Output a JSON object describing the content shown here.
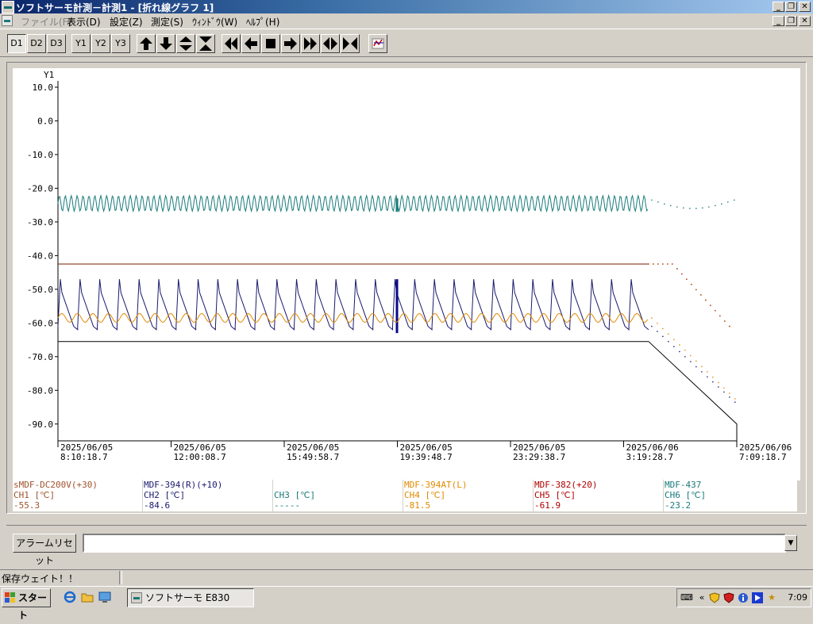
{
  "window": {
    "title": "ソフトサーモ計測－計測1 - [折れ線グラフ 1]",
    "min_glyph": "_",
    "restore_glyph": "❐",
    "close_glyph": "✕"
  },
  "menu": {
    "items": [
      {
        "label": "ファイル(F)",
        "enabled": false
      },
      {
        "label": "表示(D)",
        "enabled": true
      },
      {
        "label": "設定(Z)",
        "enabled": true
      },
      {
        "label": "測定(S)",
        "enabled": true
      },
      {
        "label": "ｳｨﾝﾄﾞｳ(W)",
        "enabled": true
      },
      {
        "label": "ﾍﾙﾌﾟ(H)",
        "enabled": true
      }
    ]
  },
  "toolbar": {
    "display_buttons": [
      "D1",
      "D2",
      "D3"
    ],
    "axis_buttons": [
      "Y1",
      "Y2",
      "Y3"
    ],
    "arrow_buttons": [
      "arrow-up-icon",
      "arrow-down-icon",
      "expand-vertical-icon",
      "shrink-vertical-icon"
    ],
    "nav_buttons": [
      "fast-rewind-icon",
      "step-back-icon",
      "stop-icon",
      "step-forward-icon",
      "fast-forward-icon",
      "expand-horizontal-icon",
      "shrink-horizontal-icon"
    ],
    "extra_button": "graph-settings-icon"
  },
  "chart_data": {
    "type": "line",
    "y_axis_title": "Y1",
    "ylim": [
      -95,
      10
    ],
    "y_ticks": [
      {
        "value": 10,
        "label": "10.0"
      },
      {
        "value": 0,
        "label": "0.0"
      },
      {
        "value": -10,
        "label": "-10.0"
      },
      {
        "value": -20,
        "label": "-20.0"
      },
      {
        "value": -30,
        "label": "-30.0"
      },
      {
        "value": -40,
        "label": "-40.0"
      },
      {
        "value": -50,
        "label": "-50.0"
      },
      {
        "value": -60,
        "label": "-60.0"
      },
      {
        "value": -70,
        "label": "-70.0"
      },
      {
        "value": -80,
        "label": "-80.0"
      },
      {
        "value": -90,
        "label": "-90.0"
      }
    ],
    "x_ticks": [
      {
        "date": "2025/06/05",
        "time": "8:10:18.7"
      },
      {
        "date": "2025/06/05",
        "time": "12:00:08.7"
      },
      {
        "date": "2025/06/05",
        "time": "15:49:58.7"
      },
      {
        "date": "2025/06/05",
        "time": "19:39:48.7"
      },
      {
        "date": "2025/06/05",
        "time": "23:29:38.7"
      },
      {
        "date": "2025/06/06",
        "time": "3:19:28.7"
      },
      {
        "date": "2025/06/06",
        "time": "7:09:18.7"
      }
    ],
    "grid": false,
    "series": [
      {
        "name": "sMDF-DC200V(+30)",
        "channel": "CH1",
        "color": "#7a1e00",
        "pattern": "step",
        "level_main": -42.5,
        "level_end": -61.0,
        "last": -55.3
      },
      {
        "name": "MDF-394(R)(+10)",
        "channel": "CH2",
        "color": "#1a1a6e",
        "pattern": "sawtooth",
        "min": -62.0,
        "max": -47.0,
        "last": -84.6
      },
      {
        "name": "MDF-394AT(L)",
        "channel": "CH4",
        "color": "#e08a00",
        "pattern": "sine",
        "center": -58.5,
        "amplitude": 1.3,
        "last": -81.5
      },
      {
        "name": "MDF-382(+20)",
        "channel": "CH5",
        "color": "#000000",
        "pattern": "step",
        "level_main": -65.5,
        "level_end": -90.0,
        "last": -61.9
      },
      {
        "name": "MDF-437",
        "channel": "CH6",
        "color": "#1a7a7a",
        "pattern": "sine",
        "center": -24.5,
        "amplitude": 2.3,
        "last": -23.2
      }
    ]
  },
  "legend": [
    {
      "name": "sMDF-DC200V(+30)",
      "channel": "CH1 [℃]",
      "value": "-55.3",
      "color": "#a0522d"
    },
    {
      "name": "MDF-394(R)(+10)",
      "channel": "CH2 [℃]",
      "value": "-84.6",
      "color": "#1a1a6e"
    },
    {
      "name": "",
      "channel": "CH3 [℃]",
      "value": "-----",
      "color": "#1a7a7a"
    },
    {
      "name": "MDF-394AT(L)",
      "channel": "CH4 [℃]",
      "value": "-81.5",
      "color": "#e08a00"
    },
    {
      "name": "MDF-382(+20)",
      "channel": "CH5 [℃]",
      "value": "-61.9",
      "color": "#b00000"
    },
    {
      "name": "MDF-437",
      "channel": "CH6 [℃]",
      "value": "-23.2",
      "color": "#1a7a7a"
    }
  ],
  "alarm": {
    "reset_label": "アラームリセット",
    "dropdown_glyph": "▼"
  },
  "status": {
    "text": "保存ウェイト！！"
  },
  "taskbar": {
    "start_label": "スタート",
    "task_label": "ソフトサーモ  E830",
    "clock": "7:09",
    "tray_chevron": "«"
  }
}
